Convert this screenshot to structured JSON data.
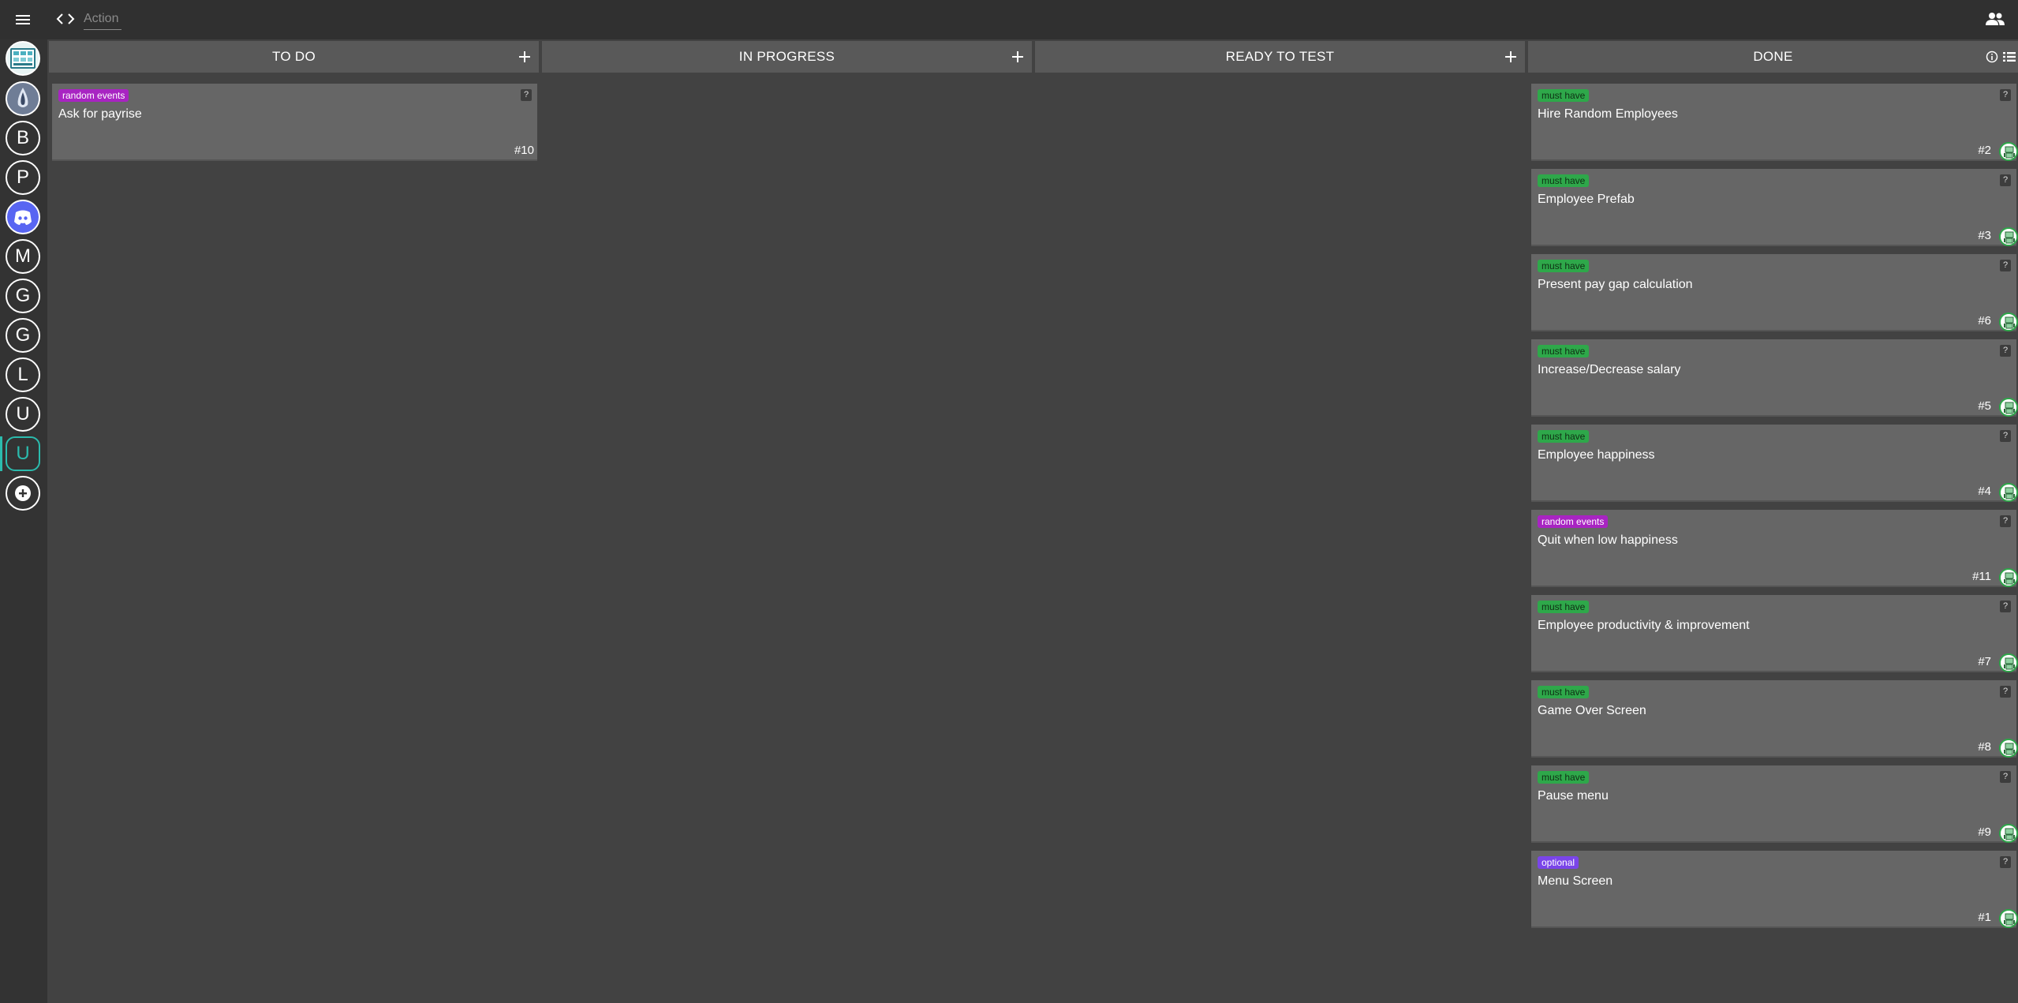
{
  "topbar": {
    "action_placeholder": "Action",
    "menu_icon": "hamburger-menu-icon",
    "code_icon": "code-brackets-icon",
    "people_icon": "people-icon"
  },
  "sidebar": {
    "items": [
      {
        "label": "",
        "icon": "app-logo-icon"
      },
      {
        "label": "",
        "icon": "droplet-logo-icon"
      },
      {
        "label": "B"
      },
      {
        "label": "P"
      },
      {
        "label": "",
        "icon": "discord-icon"
      },
      {
        "label": "M"
      },
      {
        "label": "G"
      },
      {
        "label": "G"
      },
      {
        "label": "L"
      },
      {
        "label": "U"
      },
      {
        "label": "U",
        "active": true
      },
      {
        "label": "",
        "icon": "add-circle-icon"
      }
    ]
  },
  "colors": {
    "accent": "#2bbbad",
    "must_have": "#2ea84a",
    "random_events": "#a824c2",
    "optional": "#7a45e8"
  },
  "columns": [
    {
      "title": "TO DO",
      "action_icon": "plus-icon",
      "cards": [
        {
          "tag": "random events",
          "tag_type": "random",
          "title": "Ask for payrise",
          "number": "#10",
          "help": "?",
          "assigned": false
        }
      ]
    },
    {
      "title": "IN PROGRESS",
      "action_icon": "plus-icon",
      "cards": []
    },
    {
      "title": "READY TO TEST",
      "action_icon": "plus-icon",
      "cards": []
    },
    {
      "title": "DONE",
      "action_icon": "info-icon",
      "extra_icon": "list-icon",
      "cards": [
        {
          "tag": "must have",
          "tag_type": "must",
          "title": "Hire Random Employees",
          "number": "#2",
          "help": "?",
          "assigned": true
        },
        {
          "tag": "must have",
          "tag_type": "must",
          "title": "Employee Prefab",
          "number": "#3",
          "help": "?",
          "assigned": true
        },
        {
          "tag": "must have",
          "tag_type": "must",
          "title": "Present pay gap calculation",
          "number": "#6",
          "help": "?",
          "assigned": true
        },
        {
          "tag": "must have",
          "tag_type": "must",
          "title": "Increase/Decrease salary",
          "number": "#5",
          "help": "?",
          "assigned": true
        },
        {
          "tag": "must have",
          "tag_type": "must",
          "title": "Employee happiness",
          "number": "#4",
          "help": "?",
          "assigned": true
        },
        {
          "tag": "random events",
          "tag_type": "random",
          "title": "Quit when low happiness",
          "number": "#11",
          "help": "?",
          "assigned": true
        },
        {
          "tag": "must have",
          "tag_type": "must",
          "title": "Employee productivity & improvement",
          "number": "#7",
          "help": "?",
          "assigned": true
        },
        {
          "tag": "must have",
          "tag_type": "must",
          "title": "Game Over Screen",
          "number": "#8",
          "help": "?",
          "assigned": true
        },
        {
          "tag": "must have",
          "tag_type": "must",
          "title": "Pause menu",
          "number": "#9",
          "help": "?",
          "assigned": true
        },
        {
          "tag": "optional",
          "tag_type": "optional",
          "title": "Menu Screen",
          "number": "#1",
          "help": "?",
          "assigned": true
        }
      ]
    }
  ]
}
